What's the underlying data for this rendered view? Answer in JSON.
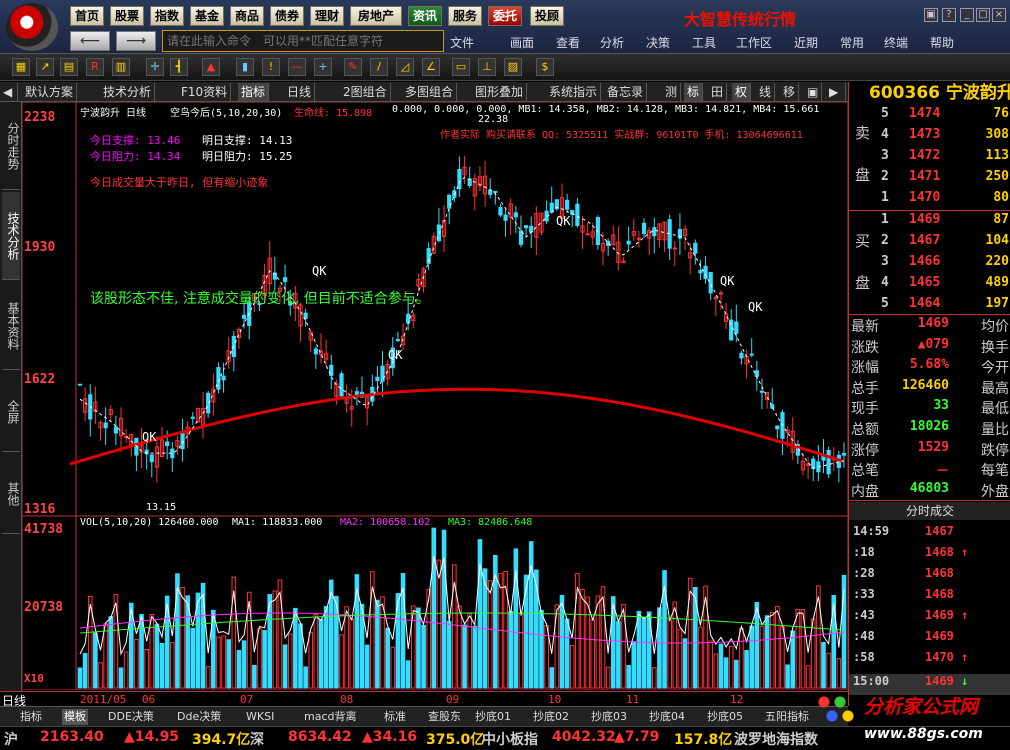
{
  "menu": [
    "首页",
    "股票",
    "指数",
    "基金",
    "商品",
    "债券",
    "理财",
    "房地产",
    "资讯",
    "服务",
    "委托",
    "投顾"
  ],
  "brand": "大智慧传统行情",
  "command_placeholder": "请在此输入命令　可以用**匹配任意字符",
  "main_menu": [
    "文件",
    "画面",
    "查看",
    "分析",
    "决策",
    "工具",
    "工作区",
    "近期",
    "常用",
    "终端",
    "帮助"
  ],
  "tabs": [
    "默认方案",
    "技术分析",
    "F10资料",
    "指标",
    "日线",
    "2图组合",
    "多图组合",
    "图形叠加",
    "系统指示",
    "备忘录",
    "测",
    "标",
    "权",
    "线",
    "移"
  ],
  "side_nav": [
    "分时走势",
    "技术分析",
    "基本资料",
    "全屏",
    "其他"
  ],
  "chart": {
    "stock_label": "宁波韵升 日线",
    "indicator_label": "空鸟今后(5,10,20,30)",
    "lifeline": "生命线: 15.898",
    "ma_line": "0.000, 0.000, 0.000, MB1: 14.358, MB2: 14.128, MB3: 14.821, MB4: 15.661",
    "support_today": "今日支撑: 13.46",
    "support_tomorrow": "明日支撑: 14.13",
    "resist_today": "今日阻力: 14.34",
    "resist_tomorrow": "明日阻力: 15.25",
    "volume_note": "今日成交量大于昨日, 但有缩小迹象",
    "author_note": "作者实际 购买请联系 QQ: 5325511 实战群: 96101T0 手机: 13064696611",
    "advice": "该股形态不佳, 注意成交量的变化, 但目前不适合参与。",
    "y_labels": [
      "2238",
      "1930",
      "1622",
      "1316"
    ],
    "high_mark": "22.38",
    "low_mark": "13.15",
    "qk": "QK"
  },
  "volume": {
    "header": "VOL(5,10,20) 126460.000",
    "ma1": "MA1: 118833.000",
    "ma2": "MA2: 100658.102",
    "ma3": "MA3: 82486.648",
    "y_labels": [
      "41738",
      "20738",
      "X10"
    ]
  },
  "x_axis": [
    "2011/05",
    "06",
    "07",
    "08",
    "09",
    "10",
    "11",
    "12"
  ],
  "period_label": "日线",
  "stock": {
    "code": "600366",
    "name": "宁波韵升"
  },
  "sell_label": [
    "卖",
    "盘"
  ],
  "buy_label": [
    "买",
    "盘"
  ],
  "sell_orders": [
    {
      "n": "5",
      "price": "1474",
      "vol": "76"
    },
    {
      "n": "4",
      "price": "1473",
      "vol": "308"
    },
    {
      "n": "3",
      "price": "1472",
      "vol": "113"
    },
    {
      "n": "2",
      "price": "1471",
      "vol": "250"
    },
    {
      "n": "1",
      "price": "1470",
      "vol": "80"
    }
  ],
  "buy_orders": [
    {
      "n": "1",
      "price": "1469",
      "vol": "87"
    },
    {
      "n": "2",
      "price": "1467",
      "vol": "104"
    },
    {
      "n": "3",
      "price": "1466",
      "vol": "220"
    },
    {
      "n": "4",
      "price": "1465",
      "vol": "489"
    },
    {
      "n": "5",
      "price": "1464",
      "vol": "197"
    }
  ],
  "stats": [
    {
      "l1": "最新",
      "v1": "1469",
      "l2": "均价"
    },
    {
      "l1": "涨跌",
      "v1": "▲079",
      "l2": "换手"
    },
    {
      "l1": "涨幅",
      "v1": "5.68%",
      "l2": "今开"
    },
    {
      "l1": "总手",
      "v1": "126460",
      "l2": "最高"
    },
    {
      "l1": "现手",
      "v1": "33",
      "l2": "最低"
    },
    {
      "l1": "总额",
      "v1": "18026",
      "l2": "量比"
    },
    {
      "l1": "涨停",
      "v1": "1529",
      "l2": "跌停"
    },
    {
      "l1": "总笔",
      "v1": "－",
      "l2": "每笔"
    },
    {
      "l1": "内盘",
      "v1": "46803",
      "l2": "外盘"
    }
  ],
  "ticks_title": "分时成交",
  "ticks": [
    {
      "t": "14:59",
      "p": "1467",
      "a": ""
    },
    {
      "t": ":18",
      "p": "1468",
      "a": "↑"
    },
    {
      "t": ":28",
      "p": "1468",
      "a": ""
    },
    {
      "t": ":33",
      "p": "1468",
      "a": ""
    },
    {
      "t": ":43",
      "p": "1469",
      "a": "↑"
    },
    {
      "t": ":48",
      "p": "1469",
      "a": ""
    },
    {
      "t": ":58",
      "p": "1470",
      "a": "↑"
    },
    {
      "t": "15:00",
      "p": "1469",
      "a": "↓"
    }
  ],
  "bottom_tabs": [
    "指标",
    "模板",
    "DDE决策",
    "Dde决策",
    "WKSI",
    "macd背离",
    "标准",
    "查股东",
    "抄底01",
    "抄底02",
    "抄底03",
    "抄底04",
    "抄底05",
    "五阳指标"
  ],
  "status": {
    "sh_label": "沪",
    "sh_value": "2163.40",
    "sh_change": "▲14.95",
    "sh_amount": "394.7亿",
    "sz_label": "深",
    "sz_value": "8634.42",
    "sz_change": "▲34.16",
    "sz_amount": "375.0亿",
    "sme_label": "中小板指",
    "sme_value": "4042.32",
    "sme_change": "▲7.79",
    "sme_amount": "157.8亿",
    "scroll": "波罗地海指数"
  },
  "watermark": "分析家公式网",
  "watermark_url": "www.88gs.com",
  "colors": {
    "up": "#ff3333",
    "down": "#33ddff",
    "ma_red": "#e00000",
    "brand": "#ee1100",
    "price": "#ffd000"
  }
}
